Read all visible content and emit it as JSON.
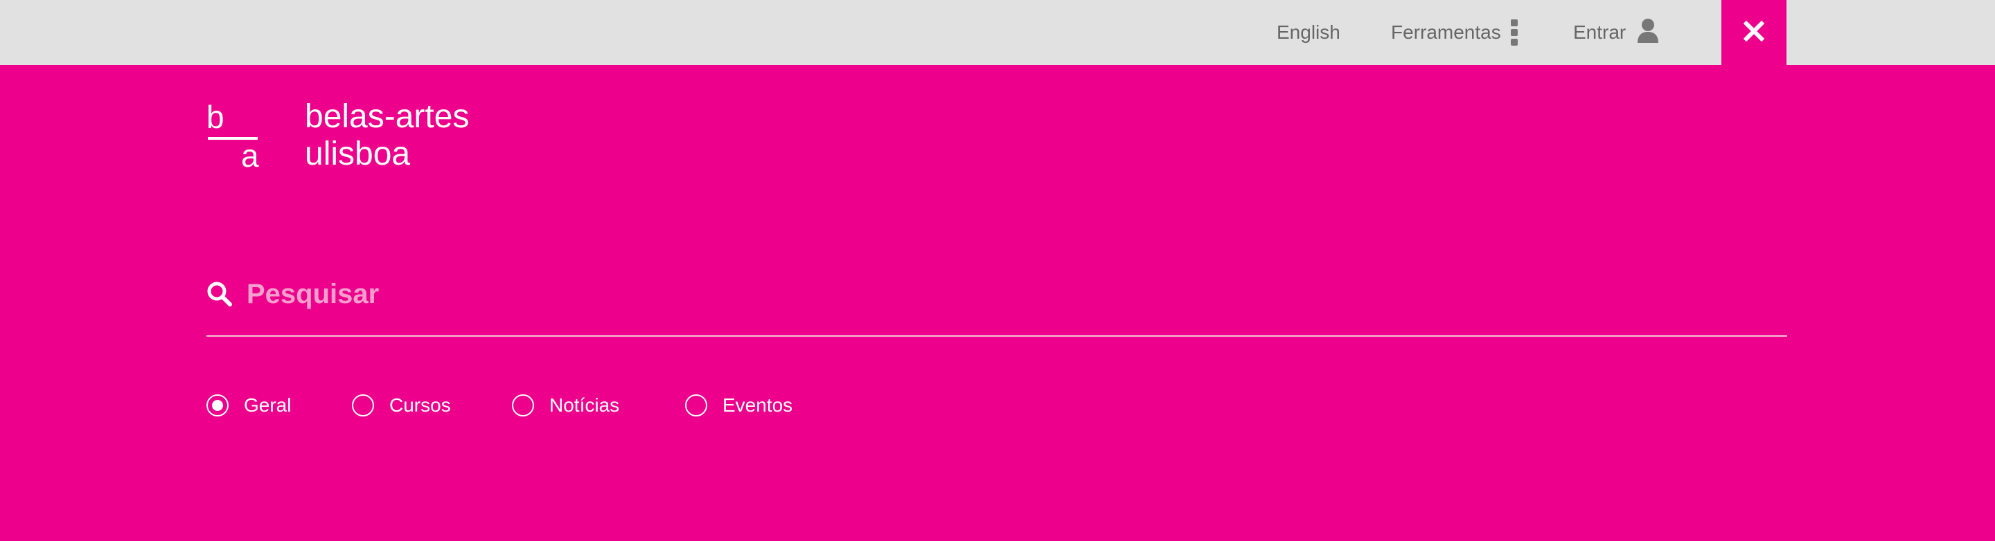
{
  "topbar": {
    "language_link": "English",
    "tools_label": "Ferramentas",
    "tools_icon": "vertical-dots-icon",
    "login_label": "Entrar",
    "login_icon": "user-icon",
    "close_icon": "close-icon"
  },
  "logo": {
    "mark_top": "b",
    "mark_bottom": "a",
    "line1": "belas-artes",
    "line2": "ulisboa"
  },
  "search": {
    "placeholder": "Pesquisar",
    "value": "",
    "icon": "search-icon"
  },
  "filters": {
    "options": [
      "Geral",
      "Cursos",
      "Notícias",
      "Eventos"
    ],
    "selected": "Geral"
  },
  "colors": {
    "brand": "#ec008c",
    "topbar": "#e1e1e1",
    "placeholder": "#f59fce"
  }
}
